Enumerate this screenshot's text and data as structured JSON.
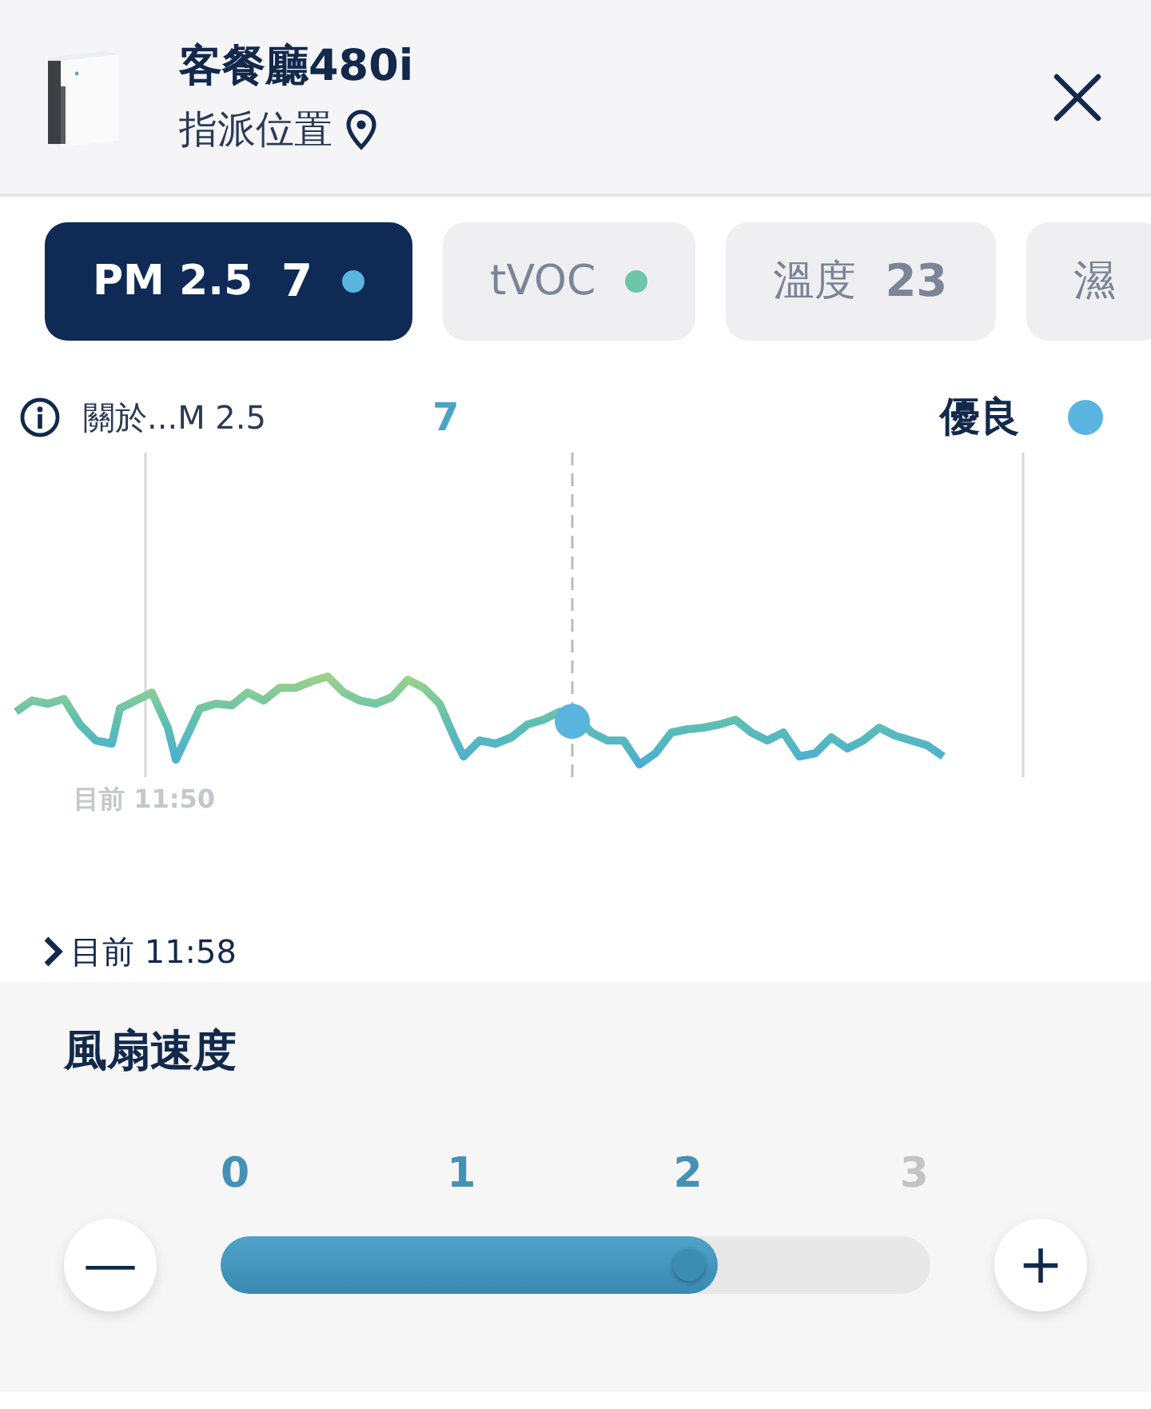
{
  "device": {
    "name": "客餐廳480i",
    "location": "指派位置"
  },
  "tabs": [
    {
      "label": "PM 2.5",
      "value": "7",
      "color": "#5ab4e0",
      "selected": true
    },
    {
      "label": "tVOC",
      "color": "#6cc6a8",
      "selected": false
    },
    {
      "label": "溫度",
      "value": "23",
      "selected": false
    },
    {
      "label": "濕",
      "selected": false
    }
  ],
  "reading": {
    "about": "關於...M 2.5",
    "value": "7",
    "status": "優良",
    "color": "#5ab4e0"
  },
  "chart": {
    "time_label": "目前 11:50",
    "now_link": "目前 11:58"
  },
  "fan": {
    "title": "風扇速度",
    "level": 0.7,
    "ticks": [
      {
        "label": "0",
        "reached": true
      },
      {
        "label": "1",
        "reached": true
      },
      {
        "label": "2",
        "reached": true
      },
      {
        "label": "3",
        "reached": false
      }
    ],
    "minus": "—",
    "plus": "+"
  }
}
